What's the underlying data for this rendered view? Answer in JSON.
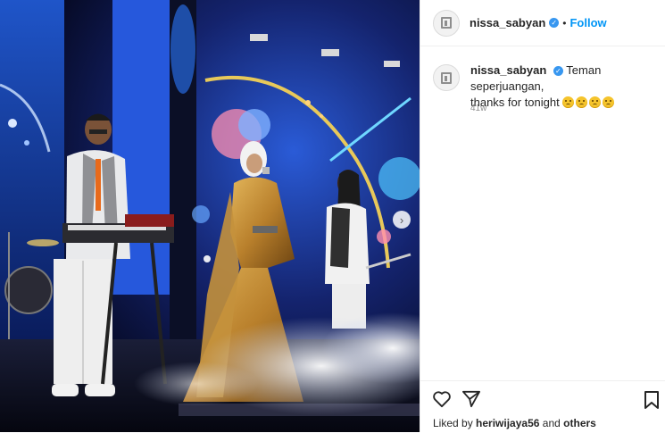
{
  "post": {
    "username": "nissa_sabyan",
    "follow_label": "Follow",
    "separator": "•",
    "caption_line1": "Teman seperjuangan,",
    "caption_line2": "thanks for tonight",
    "timestamp": "41w",
    "liked_by_prefix": "Liked by",
    "liked_by_user": "heriwijaya56",
    "liked_by_and": "and",
    "liked_by_others": "others"
  },
  "icons": [
    "heart-icon",
    "share-icon",
    "bookmark-icon",
    "verified-badge-icon",
    "carousel-next-icon"
  ],
  "colors": {
    "accent": "#0095f6",
    "verified": "#3897f0",
    "muted": "#8e8e8e",
    "text": "#262626"
  }
}
